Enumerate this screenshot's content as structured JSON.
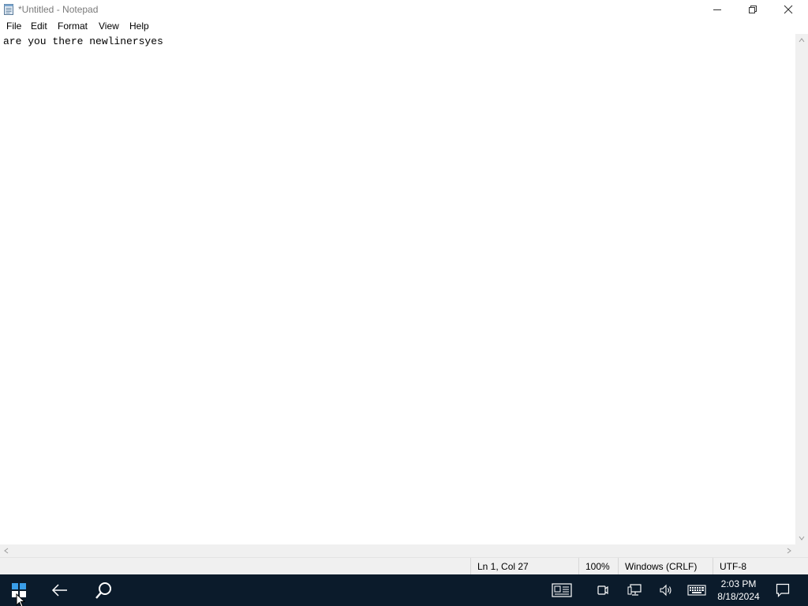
{
  "window": {
    "title": "*Untitled - Notepad"
  },
  "menu": {
    "file": "File",
    "edit": "Edit",
    "format": "Format",
    "view": "View",
    "help": "Help"
  },
  "editor": {
    "content": "are you there newlinersyes"
  },
  "statusbar": {
    "position": "Ln 1, Col 27",
    "zoom": "100%",
    "line_ending": "Windows (CRLF)",
    "encoding": "UTF-8"
  },
  "taskbar": {
    "time": "2:03 PM",
    "date": "8/18/2024",
    "icons": [
      "windows-start-icon",
      "back-arrow-icon",
      "search-icon",
      "news-widget-icon",
      "meet-now-icon",
      "network-icon",
      "volume-icon",
      "touch-keyboard-icon",
      "notification-icon"
    ]
  },
  "colors": {
    "taskbar_bg": "#0b1b2b",
    "statusbar_bg": "#f0f0f0",
    "title_text": "#7a7a7a",
    "start_accent": "#3a9ee8"
  }
}
